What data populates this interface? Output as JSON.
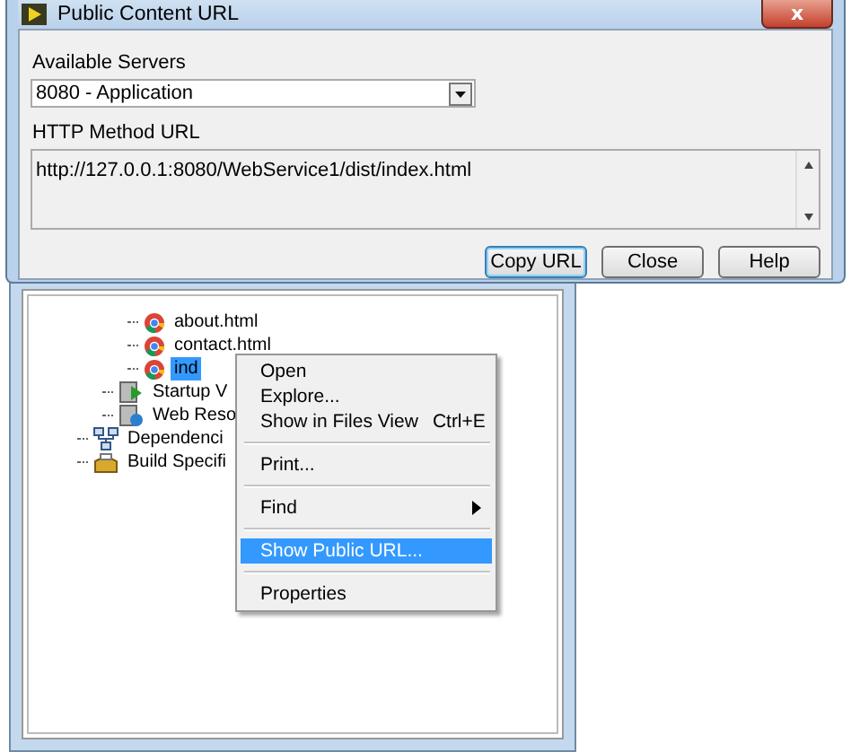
{
  "dialog": {
    "title": "Public Content URL",
    "close_glyph": "x",
    "servers_label": "Available Servers",
    "server_value": "8080 - Application",
    "url_label": "HTTP Method URL",
    "url_value": "http://127.0.0.1:8080/WebService1/dist/index.html",
    "buttons": [
      {
        "label": "Copy URL",
        "default": true
      },
      {
        "label": "Close",
        "default": false
      },
      {
        "label": "Help",
        "default": false
      }
    ]
  },
  "tree": [
    {
      "children": [
        {
          "children": [
            {
              "label": "about.html",
              "kind": "html",
              "selected": false
            },
            {
              "label": "contact.html",
              "kind": "html",
              "selected": false
            },
            {
              "label": "ind",
              "kind": "html",
              "selected": true
            }
          ]
        },
        {
          "label": "Startup V",
          "kind": "startup",
          "selected": false
        },
        {
          "label": "Web Reso",
          "kind": "web",
          "selected": false
        }
      ]
    },
    {
      "label": "Dependenci",
      "kind": "dependencies",
      "selected": false
    },
    {
      "label": "Build Specifi",
      "kind": "build",
      "selected": false
    }
  ],
  "context_menu": [
    {
      "kind": "item",
      "label": "Open",
      "selected": false
    },
    {
      "kind": "item",
      "label": "Explore...",
      "selected": false
    },
    {
      "kind": "item",
      "label": "Show in Files View",
      "shortcut": "Ctrl+E",
      "selected": false
    },
    {
      "kind": "separator"
    },
    {
      "kind": "item",
      "label": "Print...",
      "selected": false
    },
    {
      "kind": "separator"
    },
    {
      "kind": "item",
      "label": "Find",
      "submenu": true,
      "selected": false
    },
    {
      "kind": "separator"
    },
    {
      "kind": "item",
      "label": "Show Public URL...",
      "selected": true
    },
    {
      "kind": "separator"
    },
    {
      "kind": "item",
      "label": "Properties",
      "selected": false
    }
  ]
}
